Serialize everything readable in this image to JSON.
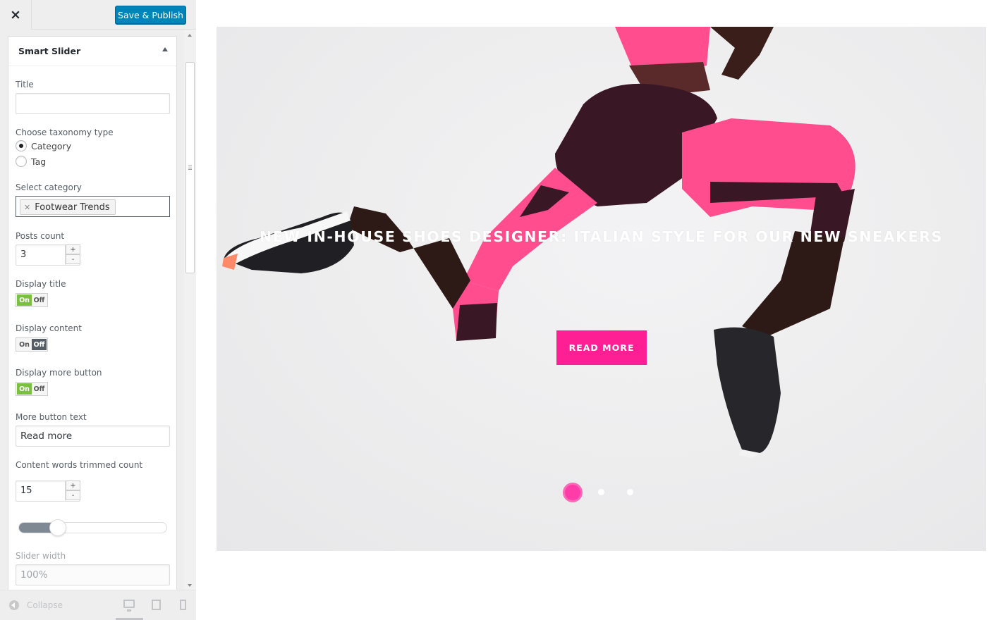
{
  "header": {
    "close_icon": "close-icon",
    "save_label": "Save & Publish",
    "accent_color": "#0085ba"
  },
  "section": {
    "title": "Smart Slider",
    "toggle_icon": "triangle-up-icon"
  },
  "fields": {
    "title_label": "Title",
    "title_value": "",
    "taxonomy_label": "Choose taxonomy type",
    "taxonomy_options": [
      "Category",
      "Tag"
    ],
    "taxonomy_selected": "Category",
    "category_label": "Select category",
    "category_selected": "Footwear Trends",
    "posts_count_label": "Posts count",
    "posts_count_value": "3",
    "spin_plus": "+",
    "spin_minus": "-",
    "display_title_label": "Display title",
    "display_title_state": "On",
    "display_content_label": "Display content",
    "display_content_state": "Off",
    "display_more_label": "Display more button",
    "display_more_state": "On",
    "toggle_on": "On",
    "toggle_off": "Off",
    "more_text_label": "More button text",
    "more_text_value": "Read more",
    "trim_label": "Content words trimmed count",
    "trim_value": "15",
    "trim_range_fraction": 0.22,
    "slider_width_label": "Slider width",
    "slider_width_value": "100%"
  },
  "footer": {
    "collapse_label": "Collapse",
    "devices": [
      "desktop-icon",
      "tablet-icon",
      "mobile-icon"
    ],
    "active_device": "desktop"
  },
  "preview": {
    "slide_title": "New in-house shoes designer: Italian style for our new sneakers",
    "read_more_label": "Read more",
    "button_color": "#ff1f95",
    "slide_count": 3,
    "active_slide": 1,
    "image": "athlete-jumping-photo"
  }
}
